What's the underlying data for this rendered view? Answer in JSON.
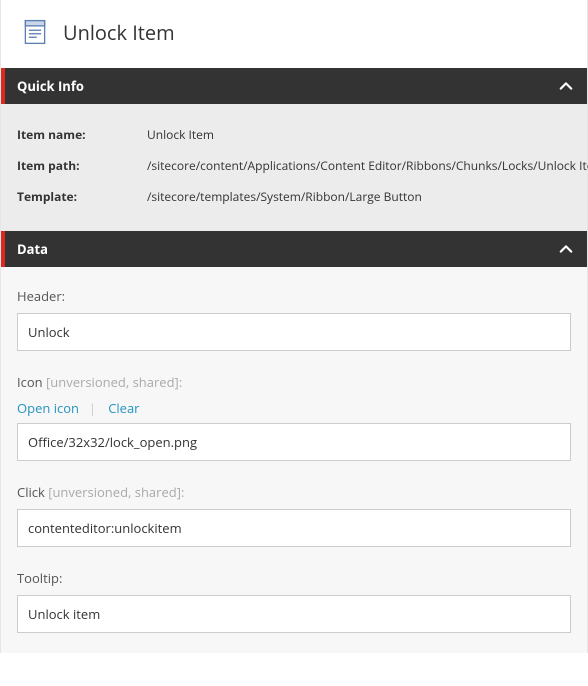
{
  "title": "Unlock Item",
  "sections": {
    "quickInfo": {
      "label": "Quick Info"
    },
    "data": {
      "label": "Data"
    }
  },
  "quickInfo": {
    "labels": {
      "name": "Item name:",
      "path": "Item path:",
      "template": "Template:"
    },
    "name": "Unlock Item",
    "path": "/sitecore/content/Applications/Content Editor/Ribbons/Chunks/Locks/Unlock Item",
    "template": "/sitecore/templates/System/Ribbon/Large Button"
  },
  "fields": {
    "header": {
      "label": "Header:",
      "value": "Unlock"
    },
    "icon": {
      "label": "Icon",
      "hint": " [unversioned, shared]:",
      "actions": {
        "open": "Open icon",
        "clear": "Clear"
      },
      "value": "Office/32x32/lock_open.png"
    },
    "click": {
      "label": "Click",
      "hint": " [unversioned, shared]:",
      "value": "contenteditor:unlockitem"
    },
    "tooltip": {
      "label": "Tooltip:",
      "value": "Unlock item"
    }
  }
}
